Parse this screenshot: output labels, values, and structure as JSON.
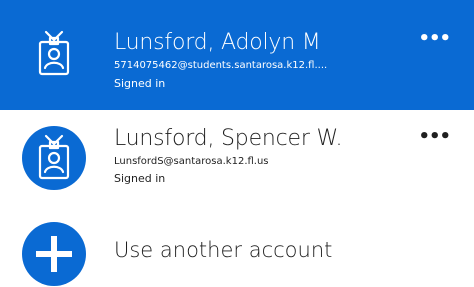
{
  "accounts": [
    {
      "name": "Lunsford, Adolyn M",
      "email": "5714075462@students.santarosa.k12.fl....",
      "status": "Signed in",
      "more": "•••",
      "icon": "id-badge-icon"
    },
    {
      "name": "Lunsford, Spencer W.",
      "email": "LunsfordS@santarosa.k12.fl.us",
      "status": "Signed in",
      "more": "•••",
      "icon": "id-badge-icon"
    }
  ],
  "add_account": {
    "label": "Use another account",
    "icon": "plus-icon"
  },
  "colors": {
    "accent": "#0a6ad3",
    "text": "#1f1f1f",
    "background": "#ffffff"
  }
}
